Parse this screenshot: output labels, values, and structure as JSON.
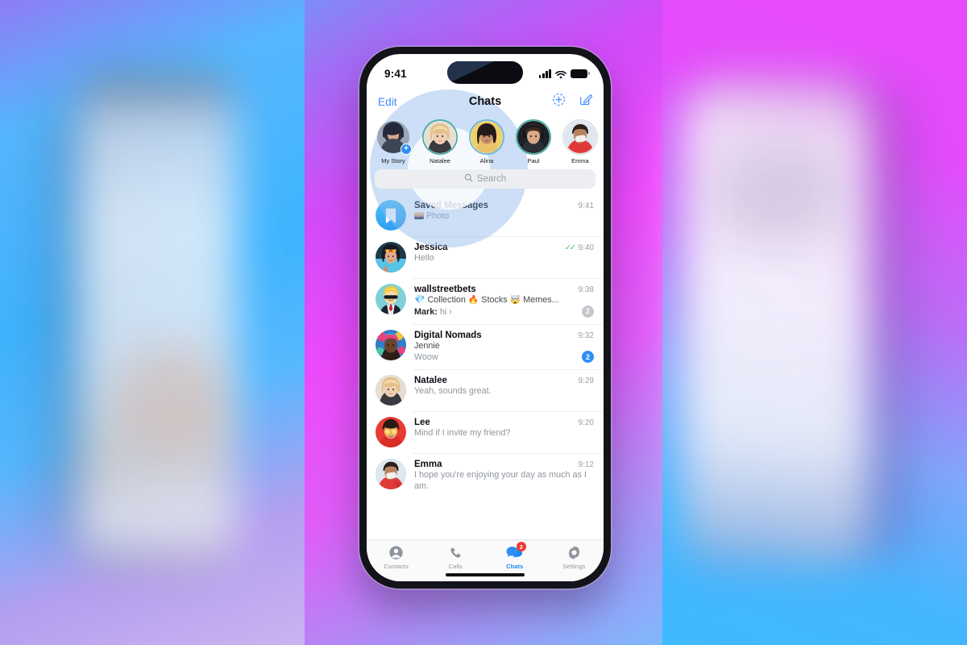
{
  "app": {
    "name": "Telegram Chats",
    "accent_blue": "#2f8ef5",
    "link_blue": "#3f8dfd",
    "badge_red": "#f03a32",
    "tick_green": "#4cc474",
    "story_ring_teal": "#3aa9a0"
  },
  "status_bar": {
    "time": "9:41",
    "signal_icon": "cellular-bars-icon",
    "wifi_icon": "wifi-icon",
    "battery_icon": "battery-icon"
  },
  "nav": {
    "edit_label": "Edit",
    "title": "Chats",
    "add_story_icon": "add-circle-dashed-icon",
    "compose_icon": "compose-icon"
  },
  "stories": [
    {
      "name": "My Story",
      "ring": "none",
      "has_plus": true,
      "avatar": "dark-haired-woman"
    },
    {
      "name": "Natalee",
      "ring": "teal",
      "has_plus": false,
      "avatar": "blonde-woman"
    },
    {
      "name": "Alina",
      "ring": "blue",
      "has_plus": false,
      "avatar": "dark-haired-woman-yellow"
    },
    {
      "name": "Paul",
      "ring": "teal",
      "has_plus": false,
      "avatar": "man-headphones"
    },
    {
      "name": "Emma",
      "ring": "grey",
      "has_plus": false,
      "avatar": "woman-red-top"
    }
  ],
  "search": {
    "placeholder": "Search",
    "icon": "search-icon"
  },
  "chats": [
    {
      "name": "Saved Messages",
      "avatar": "bookmark-icon",
      "time": "9:41",
      "preview": "Photo",
      "has_photo_thumb": true,
      "ticks": false,
      "badge": null,
      "sender": null,
      "ringed": false
    },
    {
      "name": "Jessica",
      "avatar": "woman-gold-headband",
      "time": "9:40",
      "preview": "Hello",
      "has_photo_thumb": false,
      "ticks": true,
      "badge": null,
      "sender": null,
      "ringed": false
    },
    {
      "name": "wallstreetbets",
      "avatar": "cartoon-man-sunglasses",
      "time": "9:38",
      "preview": "💎 Collection 🔥 Stocks 🤯 Memes...",
      "has_photo_thumb": false,
      "ticks": false,
      "badge": "2",
      "badge_muted": true,
      "sender": "Mark:",
      "sender_text": "hi ›",
      "ringed": false
    },
    {
      "name": "Digital Nomads",
      "avatar": "colorful-portrait",
      "time": "9:32",
      "preview": "Woow",
      "has_photo_thumb": false,
      "ticks": false,
      "badge": "2",
      "badge_muted": false,
      "sender": "Jennie",
      "ringed": false
    },
    {
      "name": "Natalee",
      "avatar": "blonde-woman",
      "time": "9:29",
      "preview": "Yeah, sounds great.",
      "has_photo_thumb": false,
      "ticks": false,
      "badge": null,
      "sender": null,
      "ringed": true
    },
    {
      "name": "Lee",
      "avatar": "person-orange-slices-eyes",
      "time": "9:20",
      "preview": "Mind if I invite my friend?",
      "has_photo_thumb": false,
      "ticks": false,
      "badge": null,
      "sender": null,
      "ringed": false
    },
    {
      "name": "Emma",
      "avatar": "woman-red-top",
      "time": "9:12",
      "preview": "I hope you're enjoying your day as much as I am.",
      "has_photo_thumb": false,
      "ticks": false,
      "badge": null,
      "sender": null,
      "ringed": true
    }
  ],
  "tabs": [
    {
      "label": "Contacts",
      "icon": "person-circle-icon",
      "active": false,
      "badge": null
    },
    {
      "label": "Calls",
      "icon": "phone-icon",
      "active": false,
      "badge": null
    },
    {
      "label": "Chats",
      "icon": "chat-bubbles-icon",
      "active": true,
      "badge": "2"
    },
    {
      "label": "Settings",
      "icon": "gear-icon",
      "active": false,
      "badge": null
    }
  ]
}
